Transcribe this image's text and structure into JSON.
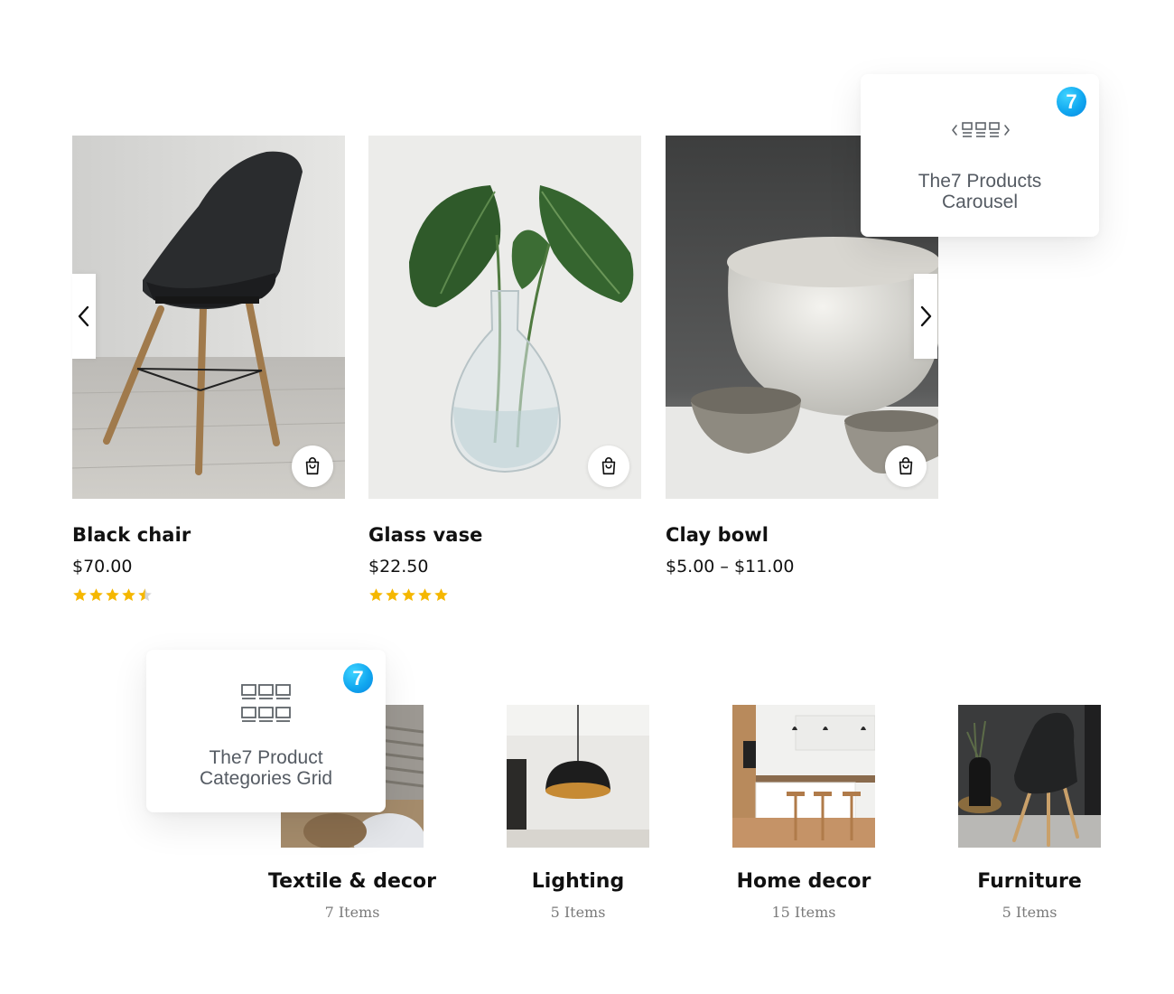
{
  "carousel": {
    "prev_icon": "chevron-left-icon",
    "next_icon": "chevron-right-icon",
    "cart_icon": "shopping-bag-icon",
    "products": [
      {
        "title": "Black chair",
        "price": "$70.00",
        "rating": 4.5,
        "rating_max": 5,
        "image": "black-chair-photo"
      },
      {
        "title": "Glass vase",
        "price": "$22.50",
        "rating": 5,
        "rating_max": 5,
        "image": "plant-in-glass-vase-photo"
      },
      {
        "title": "Clay bowl",
        "price": "$5.00 – $11.00",
        "image": "ceramic-bowls-photo"
      }
    ]
  },
  "widgets": {
    "carousel": {
      "label_line1": "The7 Products",
      "label_line2": "Carousel",
      "badge": "7",
      "icon": "carousel-icon"
    },
    "grid": {
      "label_line1": "The7 Product",
      "label_line2": "Categories Grid",
      "badge": "7",
      "icon": "grid-icon"
    }
  },
  "categories": [
    {
      "title": "Textile & decor",
      "count": "7 Items",
      "image": "textiles-photo"
    },
    {
      "title": "Lighting",
      "count": "5 Items",
      "image": "pendant-lamp-photo"
    },
    {
      "title": "Home decor",
      "count": "15 Items",
      "image": "kitchen-interior-photo"
    },
    {
      "title": "Furniture",
      "count": "5 Items",
      "image": "chair-interior-photo"
    }
  ],
  "colors": {
    "star": "#f5b700",
    "badge": "#11a8f0",
    "muted_text": "#7a7a7a",
    "widget_text": "#555b63"
  }
}
